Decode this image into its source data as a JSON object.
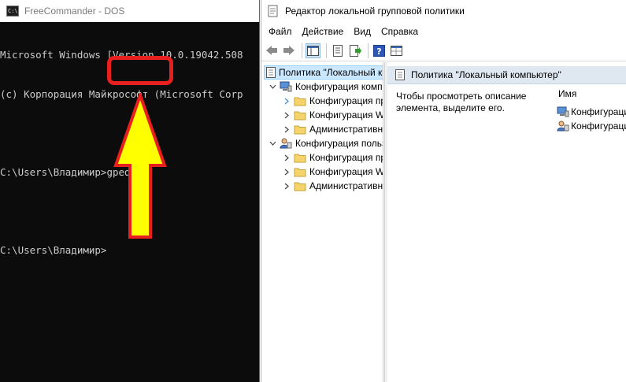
{
  "console": {
    "title": "FreeCommander - DOS",
    "icon_text": "C:\\",
    "lines": [
      "Microsoft Windows [Version 10.0.19042.508",
      "(c) Корпорация Майкрософт (Microsoft Corp",
      "",
      "C:\\Users\\Владимир>gpedit",
      "",
      "C:\\Users\\Владимир>"
    ],
    "highlight_color": "#e81f1f",
    "arrow_color": "#ffff00"
  },
  "gpedit": {
    "title": "Редактор локальной групповой политики",
    "menu": [
      "Файл",
      "Действие",
      "Вид",
      "Справка"
    ],
    "toolbar": [
      {
        "icon": "back-arrow-icon",
        "tooltip": ""
      },
      {
        "icon": "forward-arrow-icon",
        "tooltip": ""
      },
      {
        "icon": "show-hide-tree-icon",
        "tooltip": ""
      },
      {
        "icon": "properties-icon",
        "tooltip": ""
      },
      {
        "icon": "export-list-icon",
        "tooltip": ""
      },
      {
        "icon": "help-icon",
        "tooltip": ""
      },
      {
        "icon": "extended-view-icon",
        "tooltip": ""
      }
    ],
    "tree": {
      "root": "Политика \"Локальный компьютер\"",
      "computer_config": "Конфигурация компьютера",
      "user_config": "Конфигурация пользователя",
      "children": [
        "Конфигурация программ",
        "Конфигурация Windows",
        "Административные шаблоны"
      ]
    },
    "content": {
      "header_title": "Политика \"Локальный компьютер\"",
      "description": "Чтобы просмотреть описание элемента, выделите его.",
      "column_name": "Имя",
      "items": [
        "Конфигурация компьютера",
        "Конфигурация пользователя"
      ]
    },
    "colors": {
      "selection": "#cce8ff",
      "header_band": "#dfe7f1",
      "folder": "#f5d56b"
    }
  }
}
